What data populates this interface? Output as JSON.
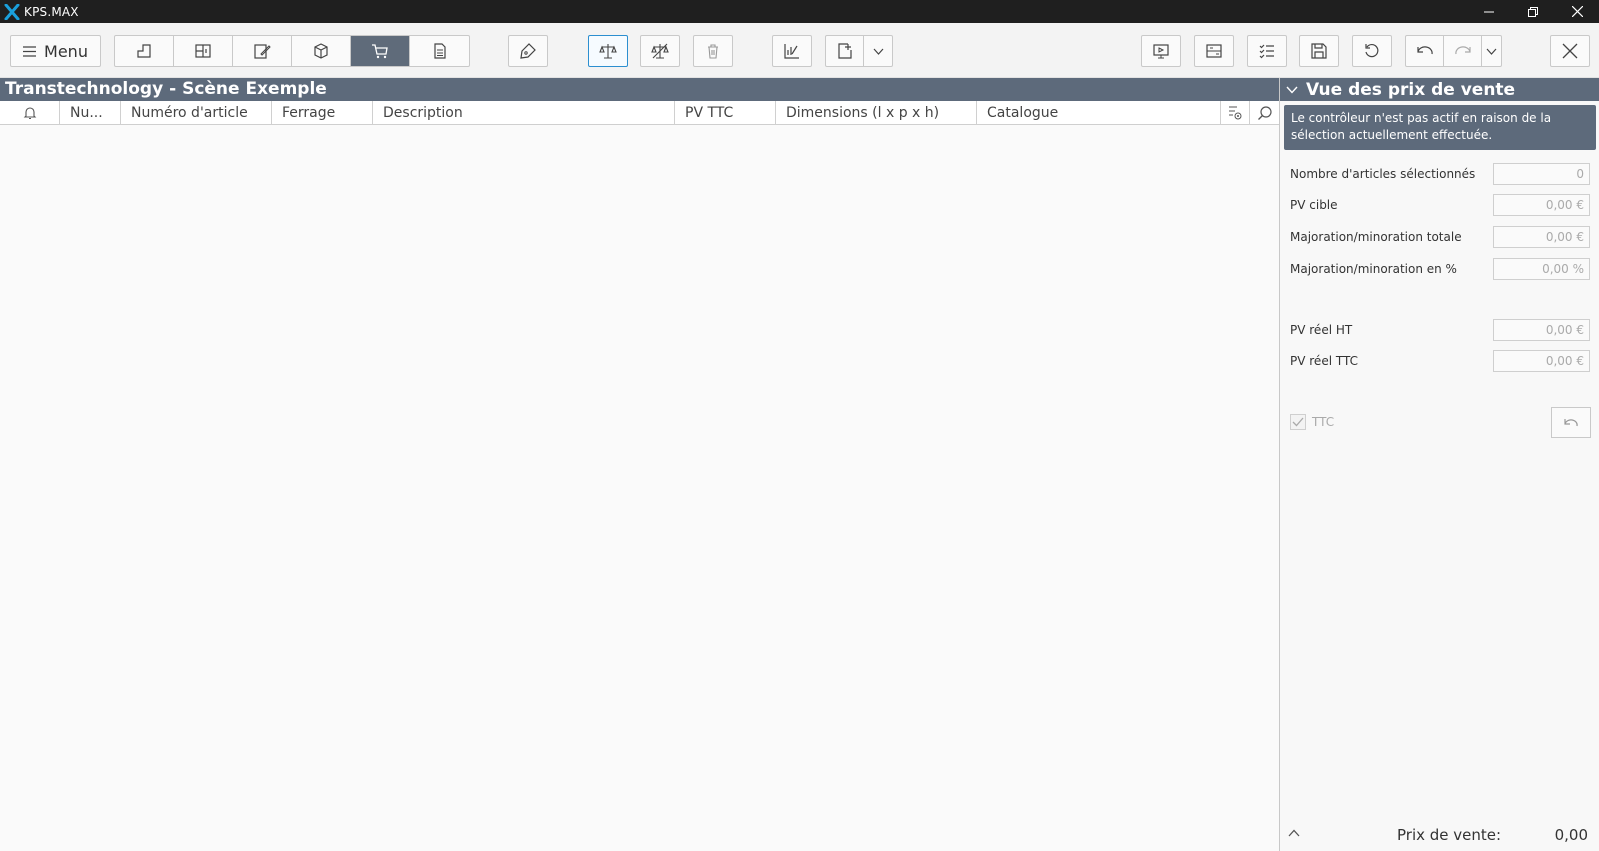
{
  "window": {
    "title": "KPS.MAX"
  },
  "toolbar": {
    "menu_label": "Menu"
  },
  "main": {
    "scene_title": "Transtechnology - Scène Exemple",
    "columns": [
      "Nu...",
      "Numéro d'article",
      "Ferrage",
      "Description",
      "PV TTC",
      "Dimensions (l x p x h)",
      "Catalogue"
    ]
  },
  "panel": {
    "title": "Vue des prix de vente",
    "notice": "Le contrôleur n'est pas actif en raison de la sélection actuellement effectuée.",
    "fields": [
      {
        "label": "Nombre d'articles sélectionnés",
        "value": "0"
      },
      {
        "label": "PV cible",
        "value": "0,00 €"
      },
      {
        "label": "Majoration/minoration totale",
        "value": "0,00 €"
      },
      {
        "label": "Majoration/minoration en %",
        "value": "0,00 %"
      },
      {
        "label": "PV réel HT",
        "value": "0,00 €"
      },
      {
        "label": "PV réel TTC",
        "value": "0,00 €"
      }
    ],
    "ttc_label": "TTC",
    "footer_label": "Prix de vente:",
    "footer_value": "0,00"
  },
  "colors": {
    "header_bg": "#5d6a7b",
    "active_blue": "#2c8fd0",
    "logo": "#1aa0dc"
  }
}
